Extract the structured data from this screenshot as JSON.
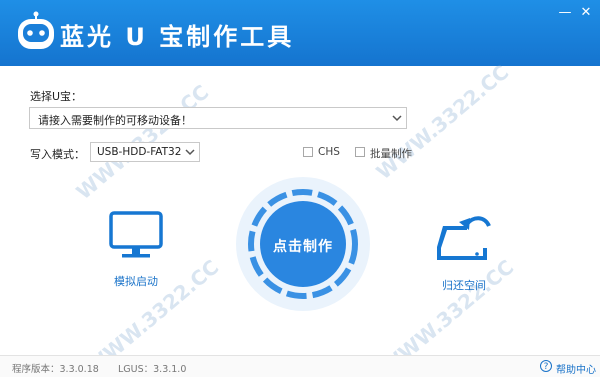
{
  "app": {
    "title": "蓝光 U 宝制作工具",
    "minimize_glyph": "—",
    "close_glyph": "✕"
  },
  "device": {
    "label": "选择U宝：",
    "value": "请接入需要制作的可移动设备！"
  },
  "write_mode": {
    "label": "写入模式：",
    "value": "USB-HDD-FAT32"
  },
  "options": {
    "chs": {
      "label": "CHS",
      "checked": false
    },
    "batch": {
      "label": "批量制作",
      "checked": false
    }
  },
  "actions": {
    "simulate_boot": "模拟启动",
    "start_make": "点击制作",
    "restore_space": "归还空间"
  },
  "status": {
    "program_version": "程序版本：3.3.0.18",
    "lgus_version": "LGUS：3.3.1.0",
    "help": "帮助中心",
    "help_glyph": "?"
  },
  "watermark": "WWW.3322.CC",
  "colors": {
    "brand_blue": "#1677d2",
    "accent_blue": "#2a86e0"
  }
}
